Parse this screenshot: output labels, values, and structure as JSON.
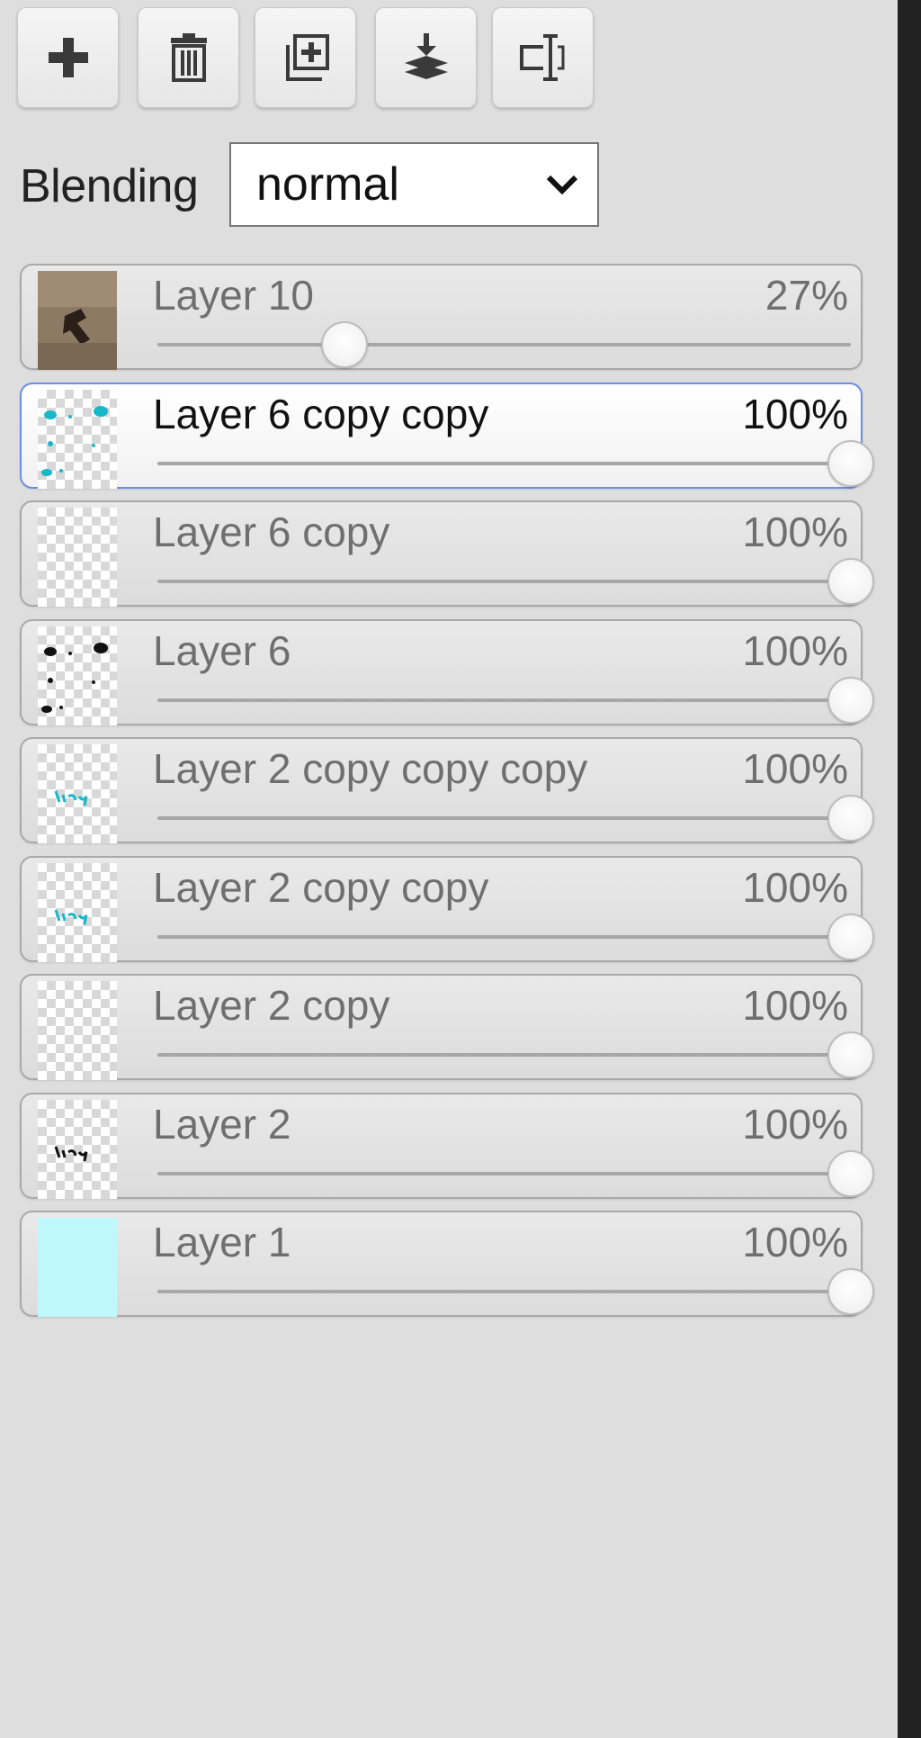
{
  "toolbar": {
    "buttons": [
      {
        "name": "add-layer",
        "icon": "plus-icon"
      },
      {
        "name": "delete-layer",
        "icon": "trash-icon"
      },
      {
        "name": "duplicate-layer",
        "icon": "duplicate-icon"
      },
      {
        "name": "merge-down",
        "icon": "merge-down-icon"
      },
      {
        "name": "rename-layer",
        "icon": "rename-icon"
      }
    ]
  },
  "blending": {
    "label": "Blending",
    "selected": "normal"
  },
  "layers": [
    {
      "name": "Layer 10",
      "opacity_text": "27%",
      "opacity": 0.27,
      "selected": false,
      "thumb": "photo"
    },
    {
      "name": "Layer 6 copy copy",
      "opacity_text": "100%",
      "opacity": 1.0,
      "selected": true,
      "thumb": "cyan-dots"
    },
    {
      "name": "Layer 6 copy",
      "opacity_text": "100%",
      "opacity": 1.0,
      "selected": false,
      "thumb": "empty"
    },
    {
      "name": "Layer 6",
      "opacity_text": "100%",
      "opacity": 1.0,
      "selected": false,
      "thumb": "black-dots"
    },
    {
      "name": "Layer 2 copy copy copy",
      "opacity_text": "100%",
      "opacity": 1.0,
      "selected": false,
      "thumb": "cyan-text"
    },
    {
      "name": "Layer 2 copy copy",
      "opacity_text": "100%",
      "opacity": 1.0,
      "selected": false,
      "thumb": "cyan-text"
    },
    {
      "name": "Layer 2 copy",
      "opacity_text": "100%",
      "opacity": 1.0,
      "selected": false,
      "thumb": "empty"
    },
    {
      "name": "Layer 2",
      "opacity_text": "100%",
      "opacity": 1.0,
      "selected": false,
      "thumb": "black-text"
    },
    {
      "name": "Layer 1",
      "opacity_text": "100%",
      "opacity": 1.0,
      "selected": false,
      "thumb": "solid-cyan"
    }
  ],
  "colors": {
    "selection_border": "#6b8ee6",
    "layer1_fill": "#bff8fb",
    "cyan_ink": "#17b9c9"
  }
}
